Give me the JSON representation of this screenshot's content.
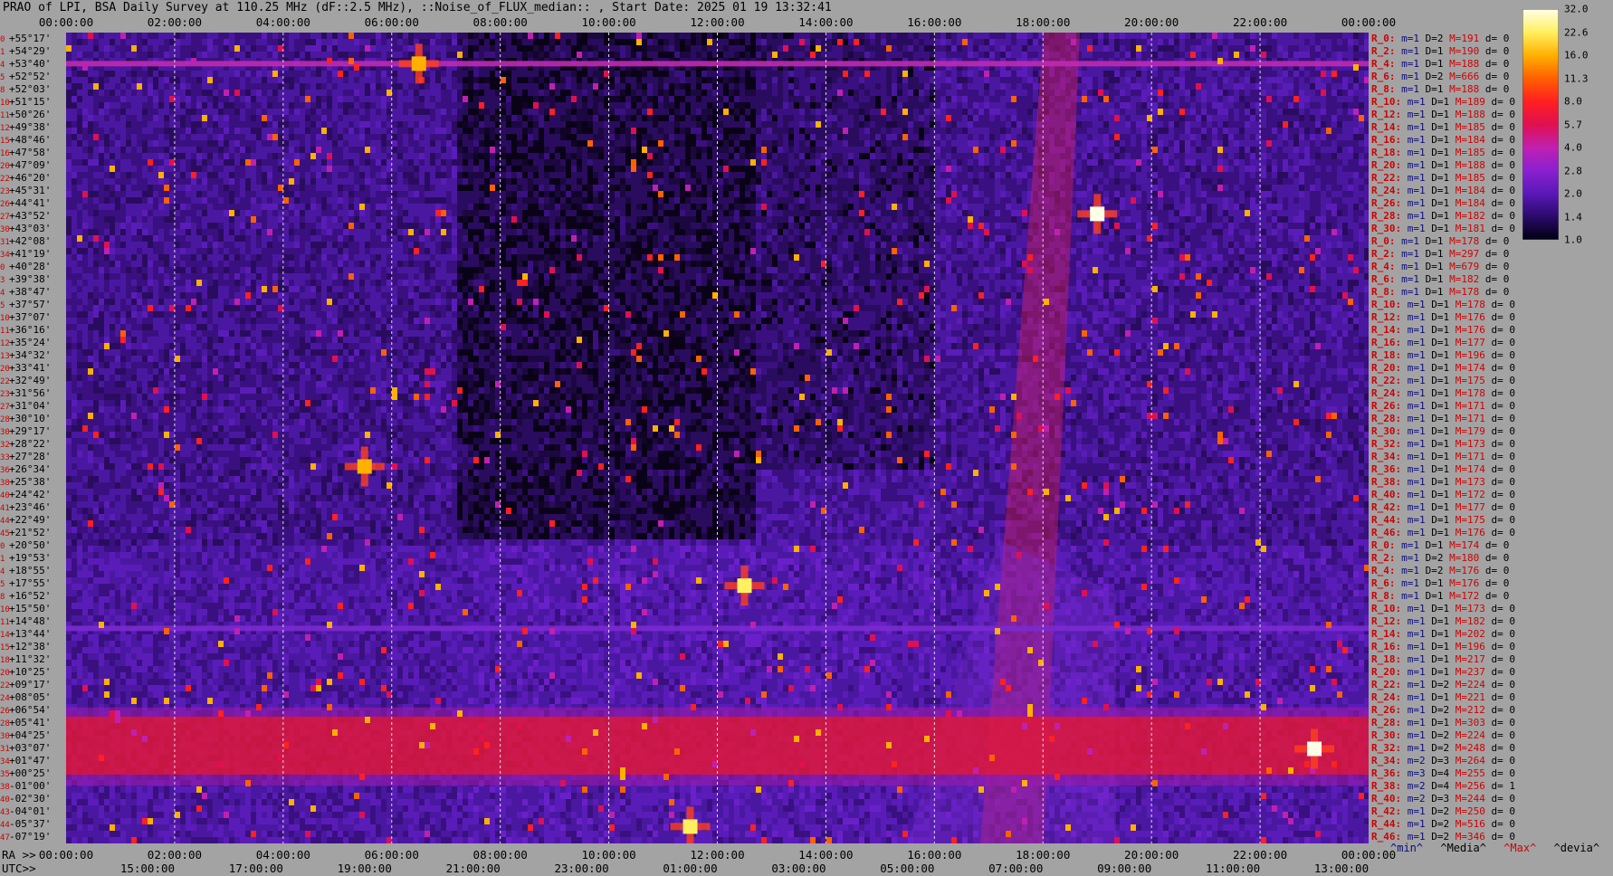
{
  "title": "PRAO of LPI, BSA Daily Survey at 110.25 MHz (dF::2.5 MHz), ::Noise_of_FLUX_median:: , Start Date: 2025 01 19 13:32:41",
  "top_ticks": [
    "00:00:00",
    "02:00:00",
    "04:00:00",
    "06:00:00",
    "08:00:00",
    "10:00:00",
    "12:00:00",
    "14:00:00",
    "16:00:00",
    "18:00:00",
    "20:00:00",
    "22:00:00",
    "00:00:00"
  ],
  "ra_label": "RA >>",
  "ra_ticks": [
    "00:00:00",
    "02:00:00",
    "04:00:00",
    "06:00:00",
    "08:00:00",
    "10:00:00",
    "12:00:00",
    "14:00:00",
    "16:00:00",
    "18:00:00",
    "20:00:00",
    "22:00:00",
    "00:00:00"
  ],
  "utc_label": "UTC>>",
  "utc_ticks": [
    "15:00:00",
    "17:00:00",
    "19:00:00",
    "21:00:00",
    "23:00:00",
    "01:00:00",
    "03:00:00",
    "05:00:00",
    "07:00:00",
    "09:00:00",
    "11:00:00",
    "13:00:00"
  ],
  "colorbar": {
    "ticks": [
      "32.0",
      "22.6",
      "16.0",
      "11.3",
      "8.0",
      "5.7",
      "4.0",
      "2.8",
      "2.0",
      "1.4",
      "1.0"
    ],
    "colors": [
      "#ffffe8",
      "#fff060",
      "#ffb000",
      "#ff6000",
      "#ff2020",
      "#e01050",
      "#c020b0",
      "#8a20d0",
      "#5a18b8",
      "#2a0a6a",
      "#000010"
    ]
  },
  "declinations": [
    {
      "i": "0",
      "d": "+55°17'"
    },
    {
      "i": "1",
      "d": "+54°29'"
    },
    {
      "i": "4",
      "d": "+53°40'"
    },
    {
      "i": "5",
      "d": "+52°52'"
    },
    {
      "i": "8",
      "d": "+52°03'"
    },
    {
      "i": "10",
      "d": "+51°15'"
    },
    {
      "i": "11",
      "d": "+50°26'"
    },
    {
      "i": "12",
      "d": "+49°38'"
    },
    {
      "i": "15",
      "d": "+48°46'"
    },
    {
      "i": "16",
      "d": "+47°58'"
    },
    {
      "i": "20",
      "d": "+47°09'"
    },
    {
      "i": "22",
      "d": "+46°20'"
    },
    {
      "i": "23",
      "d": "+45°31'"
    },
    {
      "i": "26",
      "d": "+44°41'"
    },
    {
      "i": "27",
      "d": "+43°52'"
    },
    {
      "i": "30",
      "d": "+43°03'"
    },
    {
      "i": "31",
      "d": "+42°08'"
    },
    {
      "i": "34",
      "d": "+41°19'"
    },
    {
      "i": "0",
      "d": "+40°28'"
    },
    {
      "i": "3",
      "d": "+39°38'"
    },
    {
      "i": "4",
      "d": "+38°47'"
    },
    {
      "i": "5",
      "d": "+37°57'"
    },
    {
      "i": "10",
      "d": "+37°07'"
    },
    {
      "i": "11",
      "d": "+36°16'"
    },
    {
      "i": "12",
      "d": "+35°24'"
    },
    {
      "i": "13",
      "d": "+34°32'"
    },
    {
      "i": "20",
      "d": "+33°41'"
    },
    {
      "i": "22",
      "d": "+32°49'"
    },
    {
      "i": "23",
      "d": "+31°56'"
    },
    {
      "i": "27",
      "d": "+31°04'"
    },
    {
      "i": "28",
      "d": "+30°10'"
    },
    {
      "i": "30",
      "d": "+29°17'"
    },
    {
      "i": "32",
      "d": "+28°22'"
    },
    {
      "i": "33",
      "d": "+27°28'"
    },
    {
      "i": "36",
      "d": "+26°34'"
    },
    {
      "i": "38",
      "d": "+25°38'"
    },
    {
      "i": "40",
      "d": "+24°42'"
    },
    {
      "i": "41",
      "d": "+23°46'"
    },
    {
      "i": "44",
      "d": "+22°49'"
    },
    {
      "i": "45",
      "d": "+21°52'"
    },
    {
      "i": "0",
      "d": "+20°50'"
    },
    {
      "i": "1",
      "d": "+19°53'"
    },
    {
      "i": "4",
      "d": "+18°55'"
    },
    {
      "i": "5",
      "d": "+17°55'"
    },
    {
      "i": "8",
      "d": "+16°52'"
    },
    {
      "i": "10",
      "d": "+15°50'"
    },
    {
      "i": "11",
      "d": "+14°48'"
    },
    {
      "i": "14",
      "d": "+13°44'"
    },
    {
      "i": "15",
      "d": "+12°38'"
    },
    {
      "i": "18",
      "d": "+11°32'"
    },
    {
      "i": "20",
      "d": "+10°25'"
    },
    {
      "i": "22",
      "d": "+09°17'"
    },
    {
      "i": "24",
      "d": "+08°05'"
    },
    {
      "i": "26",
      "d": "+06°54'"
    },
    {
      "i": "28",
      "d": "+05°41'"
    },
    {
      "i": "30",
      "d": "+04°25'"
    },
    {
      "i": "31",
      "d": "+03°07'"
    },
    {
      "i": "34",
      "d": "+01°47'"
    },
    {
      "i": "35",
      "d": "+00°25'"
    },
    {
      "i": "38",
      "d": "-01°00'"
    },
    {
      "i": "40",
      "d": "-02°30'"
    },
    {
      "i": "43",
      "d": "-04°01'"
    },
    {
      "i": "44",
      "d": "-05°37'"
    },
    {
      "i": "47",
      "d": "-07°19'"
    }
  ],
  "stats": [
    {
      "r": "R_0:",
      "m": "1",
      "D": "2",
      "M": "191",
      "d": "0"
    },
    {
      "r": "R_2:",
      "m": "1",
      "D": "1",
      "M": "190",
      "d": "0"
    },
    {
      "r": "R_4:",
      "m": "1",
      "D": "1",
      "M": "188",
      "d": "0"
    },
    {
      "r": "R_6:",
      "m": "1",
      "D": "2",
      "M": "666",
      "d": "0"
    },
    {
      "r": "R_8:",
      "m": "1",
      "D": "1",
      "M": "188",
      "d": "0"
    },
    {
      "r": "R_10:",
      "m": "1",
      "D": "1",
      "M": "189",
      "d": "0"
    },
    {
      "r": "R_12:",
      "m": "1",
      "D": "1",
      "M": "188",
      "d": "0"
    },
    {
      "r": "R_14:",
      "m": "1",
      "D": "1",
      "M": "185",
      "d": "0"
    },
    {
      "r": "R_16:",
      "m": "1",
      "D": "1",
      "M": "184",
      "d": "0"
    },
    {
      "r": "R_18:",
      "m": "1",
      "D": "1",
      "M": "185",
      "d": "0"
    },
    {
      "r": "R_20:",
      "m": "1",
      "D": "1",
      "M": "188",
      "d": "0"
    },
    {
      "r": "R_22:",
      "m": "1",
      "D": "1",
      "M": "185",
      "d": "0"
    },
    {
      "r": "R_24:",
      "m": "1",
      "D": "1",
      "M": "184",
      "d": "0"
    },
    {
      "r": "R_26:",
      "m": "1",
      "D": "1",
      "M": "184",
      "d": "0"
    },
    {
      "r": "R_28:",
      "m": "1",
      "D": "1",
      "M": "182",
      "d": "0"
    },
    {
      "r": "R_30:",
      "m": "1",
      "D": "1",
      "M": "181",
      "d": "0"
    },
    {
      "r": "R_0:",
      "m": "1",
      "D": "1",
      "M": "178",
      "d": "0"
    },
    {
      "r": "R_2:",
      "m": "1",
      "D": "1",
      "M": "297",
      "d": "0"
    },
    {
      "r": "R_4:",
      "m": "1",
      "D": "1",
      "M": "679",
      "d": "0"
    },
    {
      "r": "R_6:",
      "m": "1",
      "D": "1",
      "M": "182",
      "d": "0"
    },
    {
      "r": "R_8:",
      "m": "1",
      "D": "1",
      "M": "178",
      "d": "0"
    },
    {
      "r": "R_10:",
      "m": "1",
      "D": "1",
      "M": "178",
      "d": "0"
    },
    {
      "r": "R_12:",
      "m": "1",
      "D": "1",
      "M": "176",
      "d": "0"
    },
    {
      "r": "R_14:",
      "m": "1",
      "D": "1",
      "M": "176",
      "d": "0"
    },
    {
      "r": "R_16:",
      "m": "1",
      "D": "1",
      "M": "177",
      "d": "0"
    },
    {
      "r": "R_18:",
      "m": "1",
      "D": "1",
      "M": "196",
      "d": "0"
    },
    {
      "r": "R_20:",
      "m": "1",
      "D": "1",
      "M": "174",
      "d": "0"
    },
    {
      "r": "R_22:",
      "m": "1",
      "D": "1",
      "M": "175",
      "d": "0"
    },
    {
      "r": "R_24:",
      "m": "1",
      "D": "1",
      "M": "178",
      "d": "0"
    },
    {
      "r": "R_26:",
      "m": "1",
      "D": "1",
      "M": "171",
      "d": "0"
    },
    {
      "r": "R_28:",
      "m": "1",
      "D": "1",
      "M": "171",
      "d": "0"
    },
    {
      "r": "R_30:",
      "m": "1",
      "D": "1",
      "M": "179",
      "d": "0"
    },
    {
      "r": "R_32:",
      "m": "1",
      "D": "1",
      "M": "173",
      "d": "0"
    },
    {
      "r": "R_34:",
      "m": "1",
      "D": "1",
      "M": "171",
      "d": "0"
    },
    {
      "r": "R_36:",
      "m": "1",
      "D": "1",
      "M": "174",
      "d": "0"
    },
    {
      "r": "R_38:",
      "m": "1",
      "D": "1",
      "M": "173",
      "d": "0"
    },
    {
      "r": "R_40:",
      "m": "1",
      "D": "1",
      "M": "172",
      "d": "0"
    },
    {
      "r": "R_42:",
      "m": "1",
      "D": "1",
      "M": "177",
      "d": "0"
    },
    {
      "r": "R_44:",
      "m": "1",
      "D": "1",
      "M": "175",
      "d": "0"
    },
    {
      "r": "R_46:",
      "m": "1",
      "D": "1",
      "M": "176",
      "d": "0"
    },
    {
      "r": "R_0:",
      "m": "1",
      "D": "1",
      "M": "174",
      "d": "0"
    },
    {
      "r": "R_2:",
      "m": "1",
      "D": "2",
      "M": "180",
      "d": "0"
    },
    {
      "r": "R_4:",
      "m": "1",
      "D": "2",
      "M": "176",
      "d": "0"
    },
    {
      "r": "R_6:",
      "m": "1",
      "D": "1",
      "M": "176",
      "d": "0"
    },
    {
      "r": "R_8:",
      "m": "1",
      "D": "1",
      "M": "172",
      "d": "0"
    },
    {
      "r": "R_10:",
      "m": "1",
      "D": "1",
      "M": "173",
      "d": "0"
    },
    {
      "r": "R_12:",
      "m": "1",
      "D": "1",
      "M": "182",
      "d": "0"
    },
    {
      "r": "R_14:",
      "m": "1",
      "D": "1",
      "M": "202",
      "d": "0"
    },
    {
      "r": "R_16:",
      "m": "1",
      "D": "1",
      "M": "196",
      "d": "0"
    },
    {
      "r": "R_18:",
      "m": "1",
      "D": "1",
      "M": "217",
      "d": "0"
    },
    {
      "r": "R_20:",
      "m": "1",
      "D": "1",
      "M": "237",
      "d": "0"
    },
    {
      "r": "R_22:",
      "m": "1",
      "D": "2",
      "M": "224",
      "d": "0"
    },
    {
      "r": "R_24:",
      "m": "1",
      "D": "1",
      "M": "221",
      "d": "0"
    },
    {
      "r": "R_26:",
      "m": "1",
      "D": "2",
      "M": "212",
      "d": "0"
    },
    {
      "r": "R_28:",
      "m": "1",
      "D": "1",
      "M": "303",
      "d": "0"
    },
    {
      "r": "R_30:",
      "m": "1",
      "D": "2",
      "M": "224",
      "d": "0"
    },
    {
      "r": "R_32:",
      "m": "1",
      "D": "2",
      "M": "248",
      "d": "0"
    },
    {
      "r": "R_34:",
      "m": "2",
      "D": "3",
      "M": "264",
      "d": "0"
    },
    {
      "r": "R_36:",
      "m": "3",
      "D": "4",
      "M": "255",
      "d": "0"
    },
    {
      "r": "R_38:",
      "m": "2",
      "D": "4",
      "M": "256",
      "d": "1"
    },
    {
      "r": "R_40:",
      "m": "2",
      "D": "3",
      "M": "244",
      "d": "0"
    },
    {
      "r": "R_42:",
      "m": "1",
      "D": "2",
      "M": "250",
      "d": "0"
    },
    {
      "r": "R_44:",
      "m": "1",
      "D": "2",
      "M": "516",
      "d": "0"
    },
    {
      "r": "R_46:",
      "m": "1",
      "D": "2",
      "M": "346",
      "d": "0"
    }
  ],
  "legend": {
    "min": "^min^",
    "median": "^Media^",
    "max": "^Max^",
    "devia": "^devia^"
  },
  "chart_data": {
    "type": "heatmap",
    "title": "PRAO of LPI, BSA Daily Survey at 110.25 MHz (dF::2.5 MHz), ::Noise_of_FLUX_median:: , Start Date: 2025 01 19 13:32:41",
    "x_range": [
      "00:00:00",
      "00:00:00"
    ],
    "y_range": [
      "+55°17'",
      "-07°19'"
    ],
    "color_scale_range": [
      1.0,
      32.0
    ],
    "sources": [
      {
        "ra_h": 19.0,
        "dec": 41.3,
        "level": 32.0
      },
      {
        "ra_h": 23.0,
        "dec": 0.0,
        "level": 32.0
      },
      {
        "ra_h": 11.5,
        "dec": -6.0,
        "level": 24.0
      },
      {
        "ra_h": 12.5,
        "dec": 12.6,
        "level": 20.0
      },
      {
        "ra_h": 5.5,
        "dec": 21.8,
        "level": 16.0
      },
      {
        "ra_h": 6.5,
        "dec": 52.9,
        "level": 16.0
      }
    ],
    "bands": [
      {
        "name": "",
        "dec_from": 2.5,
        "dec_to": -2.0,
        "level": 6.0
      },
      {
        "name": "",
        "dec": 52.9,
        "level": 4.0
      },
      {
        "name": "",
        "dec": 9.3,
        "level": 2.8
      }
    ]
  }
}
